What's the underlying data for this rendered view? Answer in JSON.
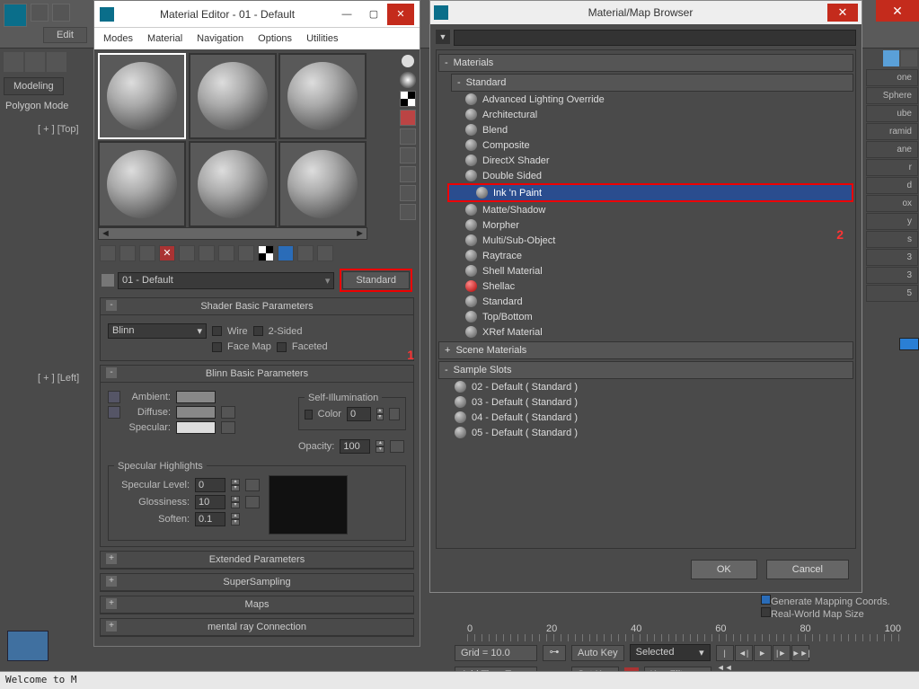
{
  "app": {
    "edit_btn": "Edit",
    "modeling_tab": "Modeling",
    "poly_label": "Polygon Mode",
    "viewport_top": "[ + ] [Top]",
    "viewport_left": "[ + ] [Left]",
    "status": "Welcome to M"
  },
  "mat_editor": {
    "title": "Material Editor - 01 - Default",
    "menu": [
      "Modes",
      "Material",
      "Navigation",
      "Options",
      "Utilities"
    ],
    "mat_name": "01 - Default",
    "type_btn": "Standard",
    "annot_1": "1",
    "rollouts": {
      "shader": {
        "title": "Shader Basic Parameters",
        "shader_dd": "Blinn",
        "wire": "Wire",
        "two_sided": "2-Sided",
        "face_map": "Face Map",
        "faceted": "Faceted"
      },
      "blinn": {
        "title": "Blinn Basic Parameters",
        "self_illum": "Self-Illumination",
        "color_label": "Color",
        "color_val": "0",
        "ambient": "Ambient:",
        "diffuse": "Diffuse:",
        "specular": "Specular:",
        "opacity": "Opacity:",
        "opacity_val": "100",
        "spec_hl": "Specular Highlights",
        "spec_level": "Specular Level:",
        "spec_level_val": "0",
        "gloss": "Glossiness:",
        "gloss_val": "10",
        "soften": "Soften:",
        "soften_val": "0.1"
      },
      "collapsed": [
        "Extended Parameters",
        "SuperSampling",
        "Maps",
        "mental ray Connection"
      ]
    }
  },
  "browser": {
    "title": "Material/Map Browser",
    "search": "",
    "annot_2": "2",
    "groups": {
      "materials": "Materials",
      "standard": "Standard",
      "scene": "Scene Materials",
      "slots": "Sample Slots"
    },
    "std_items": [
      "Advanced Lighting Override",
      "Architectural",
      "Blend",
      "Composite",
      "DirectX Shader",
      "Double Sided",
      "Ink 'n Paint",
      "Matte/Shadow",
      "Morpher",
      "Multi/Sub-Object",
      "Raytrace",
      "Shell Material",
      "Shellac",
      "Standard",
      "Top/Bottom",
      "XRef Material"
    ],
    "selected_item": "Ink 'n Paint",
    "red_item": "Shellac",
    "slot_items": [
      "02 - Default  ( Standard )",
      "03 - Default  ( Standard )",
      "04 - Default  ( Standard )",
      "05 - Default  ( Standard )"
    ],
    "ok": "OK",
    "cancel": "Cancel"
  },
  "timeline": {
    "ticks": [
      "0",
      "20",
      "40",
      "60",
      "80",
      "100"
    ],
    "grid": "Grid = 10.0",
    "add_tag": "Add Time Tag",
    "auto_key": "Auto Key",
    "set_key": "Set Key",
    "selected": "Selected",
    "key_filters": "Key Filters..."
  },
  "right": {
    "items": [
      "one",
      "Sphere",
      "ube",
      "ramid",
      "ane",
      "r",
      "d",
      "ox",
      "y",
      "s",
      "3",
      "3",
      "5"
    ],
    "gen_mapping": "Generate Mapping Coords.",
    "real_world": "Real-World Map Size"
  }
}
